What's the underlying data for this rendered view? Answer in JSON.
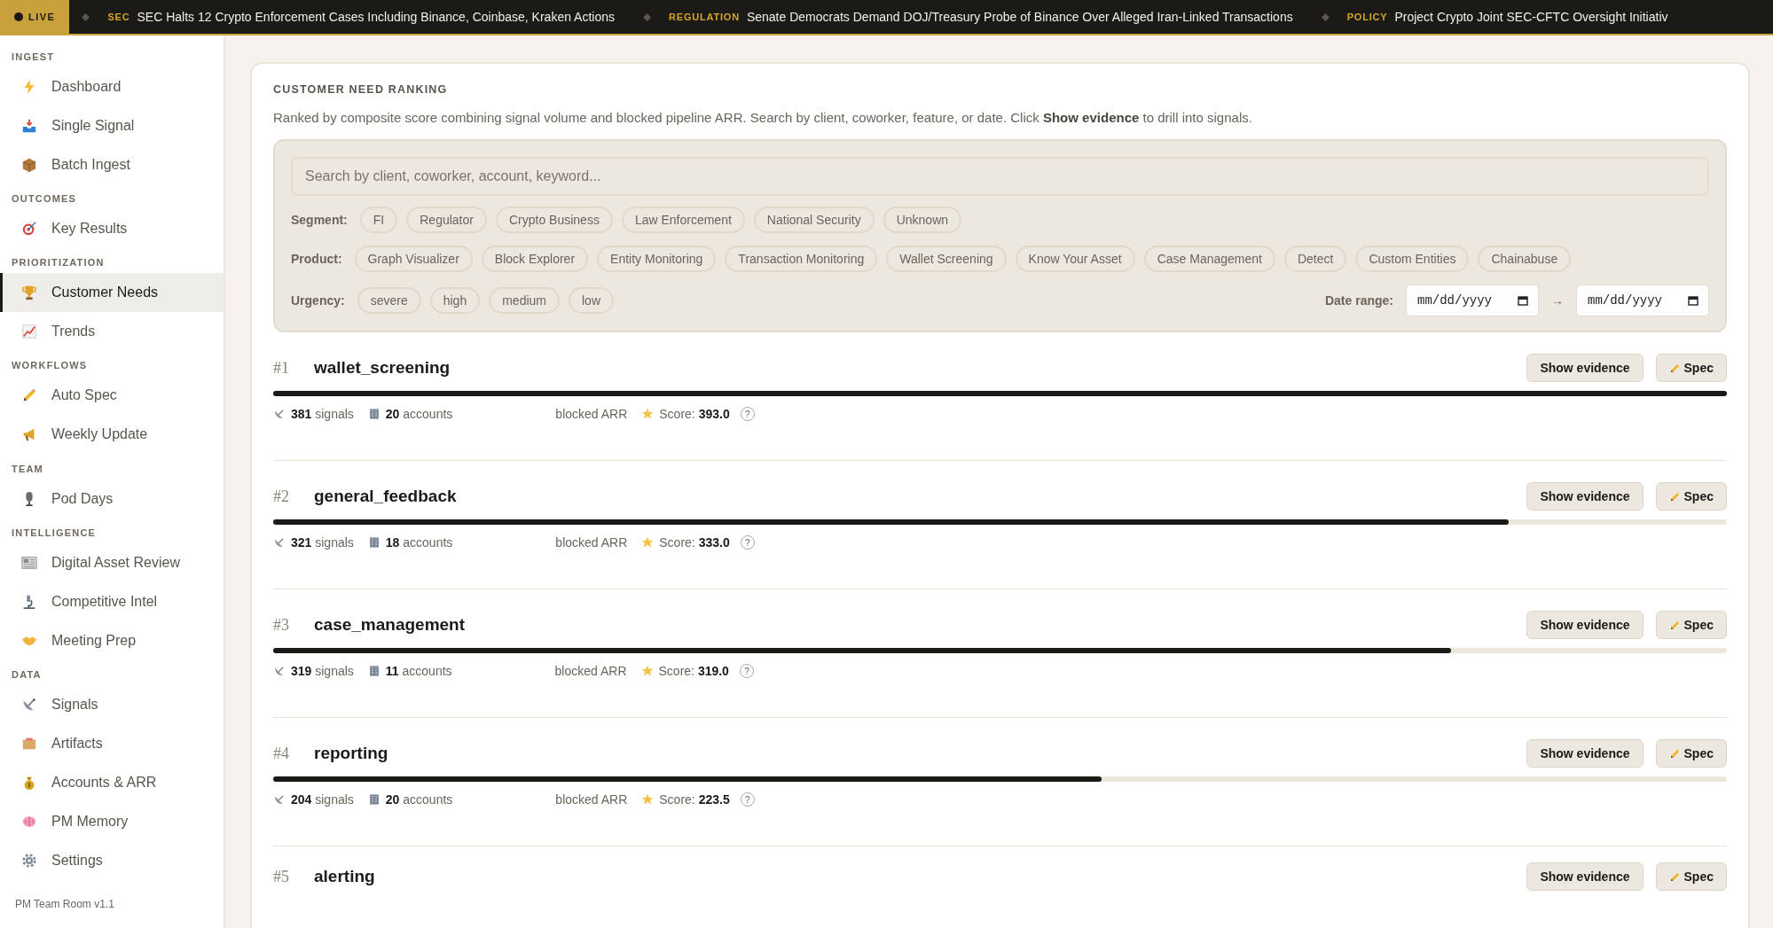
{
  "ticker": {
    "live_label": "LIVE",
    "items": [
      {
        "tag": "SEC",
        "headline": "SEC Halts 12 Crypto Enforcement Cases Including Binance, Coinbase, Kraken Actions"
      },
      {
        "tag": "REGULATION",
        "headline": "Senate Democrats Demand DOJ/Treasury Probe of Binance Over Alleged Iran-Linked Transactions"
      },
      {
        "tag": "POLICY",
        "headline": "Project Crypto Joint SEC-CFTC Oversight Initiativ"
      }
    ]
  },
  "sidebar": {
    "sections": [
      {
        "title": "INGEST",
        "items": [
          {
            "label": "Dashboard",
            "selected": false
          },
          {
            "label": "Single Signal",
            "selected": false
          },
          {
            "label": "Batch Ingest",
            "selected": false
          }
        ]
      },
      {
        "title": "OUTCOMES",
        "items": [
          {
            "label": "Key Results",
            "selected": false
          }
        ]
      },
      {
        "title": "PRIORITIZATION",
        "items": [
          {
            "label": "Customer Needs",
            "selected": true
          },
          {
            "label": "Trends",
            "selected": false
          }
        ]
      },
      {
        "title": "WORKFLOWS",
        "items": [
          {
            "label": "Auto Spec",
            "selected": false
          },
          {
            "label": "Weekly Update",
            "selected": false
          }
        ]
      },
      {
        "title": "TEAM",
        "items": [
          {
            "label": "Pod Days",
            "selected": false
          }
        ]
      },
      {
        "title": "INTELLIGENCE",
        "items": [
          {
            "label": "Digital Asset Review",
            "selected": false
          },
          {
            "label": "Competitive Intel",
            "selected": false
          },
          {
            "label": "Meeting Prep",
            "selected": false
          }
        ]
      },
      {
        "title": "DATA",
        "items": [
          {
            "label": "Signals",
            "selected": false
          },
          {
            "label": "Artifacts",
            "selected": false
          },
          {
            "label": "Accounts & ARR",
            "selected": false
          },
          {
            "label": "PM Memory",
            "selected": false
          },
          {
            "label": "Settings",
            "selected": false
          }
        ]
      }
    ],
    "footer": "PM Team Room v1.1"
  },
  "ranking": {
    "title": "CUSTOMER NEED RANKING",
    "description": "Ranked by composite score combining signal volume and blocked pipeline ARR. Search by client, coworker, feature, or date. Click **Show evidence** to drill into signals.",
    "search": {
      "placeholder": "Search by client, coworker, account, keyword..."
    },
    "filters": [
      {
        "label": "Segment:",
        "chips": [
          {
            "label": "FI",
            "selected": false
          },
          {
            "label": "Regulator",
            "selected": false
          },
          {
            "label": "Crypto Business",
            "selected": false
          },
          {
            "label": "Law Enforcement",
            "selected": false
          },
          {
            "label": "National Security",
            "selected": false
          },
          {
            "label": "Unknown",
            "selected": false
          }
        ]
      },
      {
        "label": "Product:",
        "chips": [
          {
            "label": "Graph Visualizer",
            "selected": false
          },
          {
            "label": "Block Explorer",
            "selected": false
          },
          {
            "label": "Entity Monitoring",
            "selected": false
          },
          {
            "label": "Transaction Monitoring",
            "selected": false
          },
          {
            "label": "Wallet Screening",
            "selected": false
          },
          {
            "label": "Know Your Asset",
            "selected": false
          },
          {
            "label": "Case Management",
            "selected": false
          },
          {
            "label": "Detect",
            "selected": false
          },
          {
            "label": "Custom Entities",
            "selected": false
          },
          {
            "label": "Chainabuse",
            "selected": false
          }
        ]
      },
      {
        "label": "Urgency:",
        "chips": [
          {
            "label": "severe",
            "selected": false
          },
          {
            "label": "high",
            "selected": false
          },
          {
            "label": "medium",
            "selected": false
          },
          {
            "label": "low",
            "selected": false
          }
        ]
      }
    ],
    "date_range": {
      "label": "Date range:",
      "from_placeholder": "mm/dd/yyyy",
      "separator": "→",
      "to_placeholder": "mm/dd/yyyy"
    },
    "needs": [
      {
        "rank": "#1",
        "name": "wallet_screening",
        "level": 1.0,
        "signals": "381",
        "signals_label": "signals",
        "accounts": "20",
        "accounts_label": "accounts",
        "arr_label": "blocked ARR",
        "score_label": "Score:",
        "score": "393.0",
        "help": "?",
        "evidence_button": "Show evidence",
        "spec_button": "Spec"
      },
      {
        "rank": "#2",
        "name": "general_feedback",
        "level": 0.85,
        "signals": "321",
        "signals_label": "signals",
        "accounts": "18",
        "accounts_label": "accounts",
        "arr_label": "blocked ARR",
        "score_label": "Score:",
        "score": "333.0",
        "help": "?",
        "evidence_button": "Show evidence",
        "spec_button": "Spec"
      },
      {
        "rank": "#3",
        "name": "case_management",
        "level": 0.81,
        "signals": "319",
        "signals_label": "signals",
        "accounts": "11",
        "accounts_label": "accounts",
        "arr_label": "blocked ARR",
        "score_label": "Score:",
        "score": "319.0",
        "help": "?",
        "evidence_button": "Show evidence",
        "spec_button": "Spec"
      },
      {
        "rank": "#4",
        "name": "reporting",
        "level": 0.57,
        "signals": "204",
        "signals_label": "signals",
        "accounts": "20",
        "accounts_label": "accounts",
        "arr_label": "blocked ARR",
        "score_label": "Score:",
        "score": "223.5",
        "help": "?",
        "evidence_button": "Show evidence",
        "spec_button": "Spec"
      },
      {
        "rank": "#5",
        "name": "alerting",
        "evidence_button": "Show evidence",
        "spec_button": "Spec"
      }
    ]
  }
}
